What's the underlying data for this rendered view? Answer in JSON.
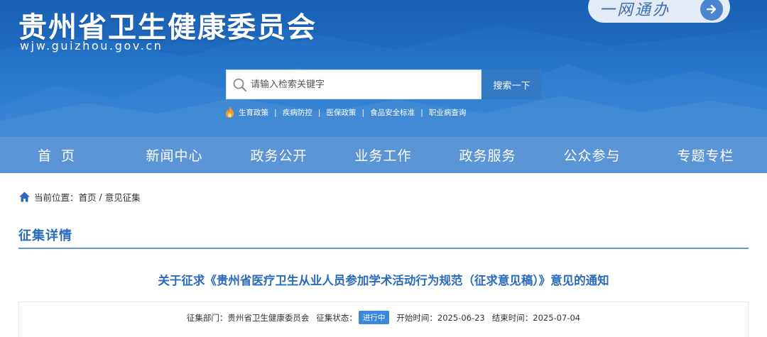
{
  "header": {
    "site_title": "贵州省卫生健康委员会",
    "site_domain": "wjw.guizhou.gov.cn",
    "one_network_label": "一网通办",
    "search": {
      "placeholder": "请输入检索关键字",
      "button_label": "搜索一下"
    },
    "hot_links": [
      "生育政策",
      "疾病防控",
      "医保政策",
      "食品安全标准",
      "职业病查询"
    ]
  },
  "nav": {
    "items": [
      "首页",
      "新闻中心",
      "政务公开",
      "业务工作",
      "政务服务",
      "公众参与",
      "专题专栏"
    ]
  },
  "breadcrumb": {
    "prefix": "当前位置：",
    "home": "首页",
    "separator": " / ",
    "current": "意见征集"
  },
  "section": {
    "title": "征集详情"
  },
  "article": {
    "title": "关于征求《贵州省医疗卫生从业人员参加学术活动行为规范（征求意见稿）》意见的通知",
    "meta": {
      "dept_label": "征集部门：",
      "dept_value": "贵州省卫生健康委员会",
      "status_label": "征集状态：",
      "status_value": "进行中",
      "start_label": "开始时间：",
      "start_value": "2025-06-23",
      "end_label": "结束时间：",
      "end_value": "2025-07-04"
    }
  },
  "colors": {
    "banner": "#2574c9",
    "nav": "#5b95d6",
    "accent": "#2b6cb8",
    "search_button": "#3479c4",
    "status_badge": "#3b87d9"
  },
  "icons": [
    "flame-icon",
    "search-icon",
    "home-icon",
    "arrow-right-icon"
  ]
}
